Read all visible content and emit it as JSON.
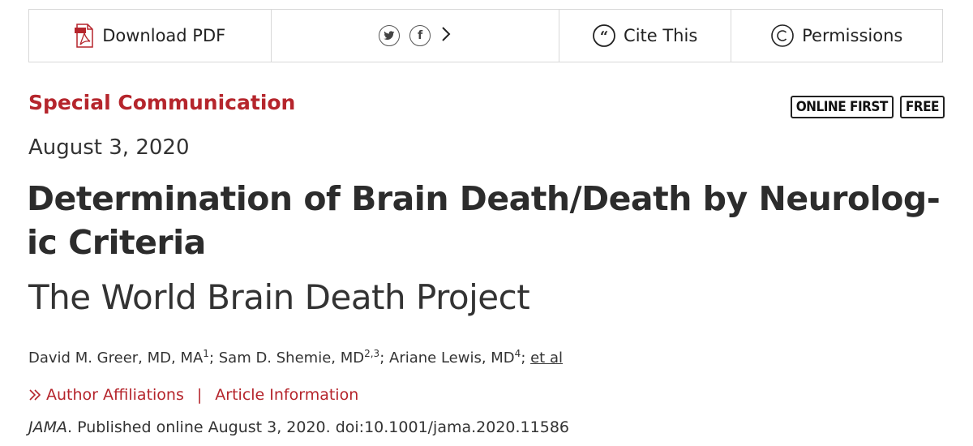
{
  "toolbar": {
    "download_label": "Download PDF",
    "cite_label": "Cite This",
    "permissions_label": "Permissions",
    "twitter_glyph": "t",
    "facebook_glyph": "f",
    "more_glyph": "›"
  },
  "article": {
    "section": "Special Communication",
    "badges": [
      "ONLINE FIRST",
      "FREE"
    ],
    "date": "August 3, 2020",
    "title": "Determination of Brain Death/Death by Neurolog-ic Criteria",
    "subtitle": "The World Brain Death Project",
    "authors": [
      {
        "name": "David M. Greer, MD, MA",
        "aff": "1"
      },
      {
        "name": "Sam D. Shemie, MD",
        "aff": "2,3"
      },
      {
        "name": "Ariane Lewis, MD",
        "aff": "4"
      }
    ],
    "et_al": "et al",
    "links": {
      "affiliations": "Author Affiliations",
      "separator": "|",
      "article_info": "Article Information"
    },
    "citation": {
      "journal": "JAMA",
      "text": ". Published online August 3, 2020. doi:10.1001/jama.2020.11586"
    }
  },
  "colors": {
    "accent": "#b5252c",
    "text": "#333333",
    "border": "#d8d8d8"
  },
  "icons": [
    "pdf-icon",
    "twitter-icon",
    "facebook-icon",
    "chevron-right-icon",
    "quote-icon",
    "copyright-icon",
    "double-chevron-right-icon"
  ]
}
